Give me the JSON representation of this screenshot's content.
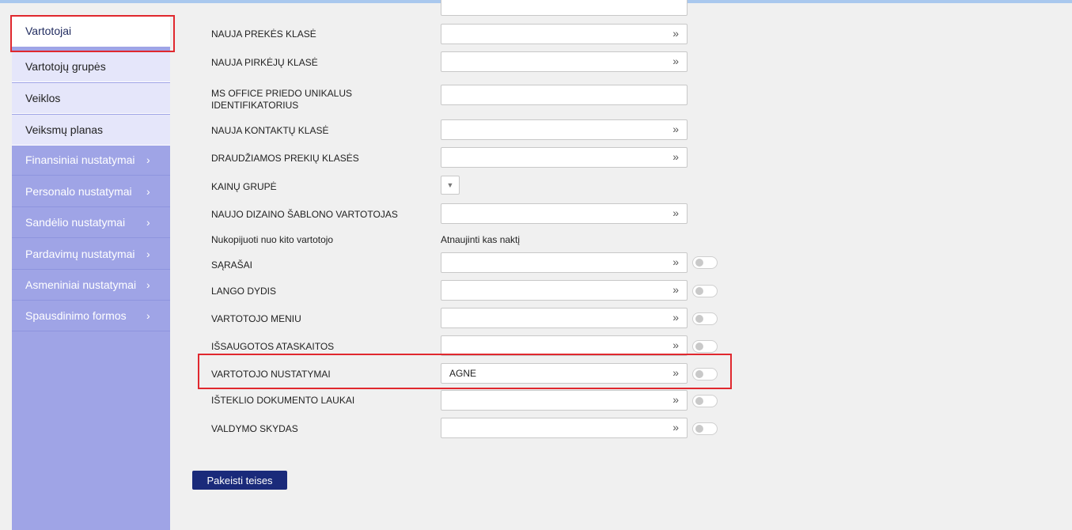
{
  "sidebar": {
    "items": [
      {
        "label": "Vartotojai"
      },
      {
        "label": "Vartotojų grupės"
      },
      {
        "label": "Veiklos"
      },
      {
        "label": "Veiksmų planas"
      }
    ],
    "groups": [
      {
        "label": "Finansiniai nustatymai",
        "icon": "chevron-right-icon"
      },
      {
        "label": "Personalo nustatymai",
        "icon": "chevron-right-icon"
      },
      {
        "label": "Sandėlio nustatymai",
        "icon": "chevron-right-icon"
      },
      {
        "label": "Pardavimų nustatymai",
        "icon": "chevron-right-icon"
      },
      {
        "label": "Asmeniniai nustatymai",
        "icon": "chevron-right-icon"
      },
      {
        "label": "Spausdinimo formos",
        "icon": "chevron-right-icon"
      }
    ]
  },
  "form": {
    "rows": [
      {
        "label": "NAUJA PREKĖS KLASĖ",
        "value": ""
      },
      {
        "label": "NAUJA PIRKĖJŲ KLASĖ",
        "value": ""
      },
      {
        "label": "MS OFFICE PRIEDO UNIKALUS IDENTIFIKATORIUS",
        "value": ""
      },
      {
        "label": "NAUJA KONTAKTŲ KLASĖ",
        "value": ""
      },
      {
        "label": "DRAUDŽIAMOS PREKIŲ KLASĖS",
        "value": ""
      },
      {
        "label": "KAINŲ GRUPĖ",
        "value": ""
      },
      {
        "label": "NAUJO DIZAINO ŠABLONO VARTOTOJAS",
        "value": ""
      },
      {
        "label": "Nukopijuoti nuo kito vartotojo",
        "value": "Atnaujinti kas naktį"
      },
      {
        "label": "SĄRAŠAI",
        "value": ""
      },
      {
        "label": "LANGO DYDIS",
        "value": ""
      },
      {
        "label": "VARTOTOJO MENIU",
        "value": ""
      },
      {
        "label": "IŠSAUGOTOS ATASKAITOS",
        "value": ""
      },
      {
        "label": "VARTOTOJO NUSTATYMAI",
        "value": "AGNE"
      },
      {
        "label": "IŠTEKLIO DOKUMENTO LAUKAI",
        "value": ""
      },
      {
        "label": "VALDYMO SKYDAS",
        "value": ""
      }
    ],
    "arrow_glyph": "»",
    "select_glyph": "▼"
  },
  "actions": {
    "change_rights_label": "Pakeisti teises"
  },
  "colors": {
    "sidebar_bg": "#9fa4e6",
    "sidebar_light": "#e5e6fa",
    "highlight": "#e0282e",
    "button_bg": "#1a2a7a"
  }
}
